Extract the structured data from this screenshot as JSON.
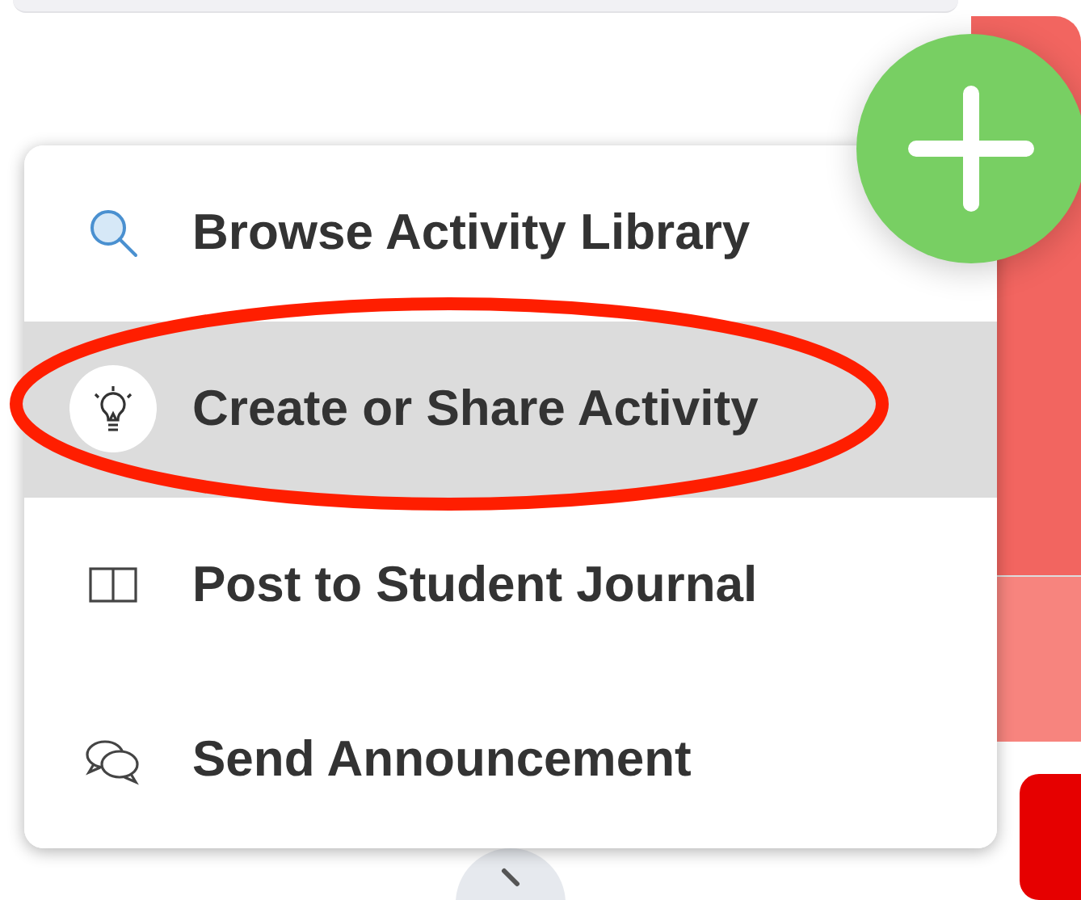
{
  "menu": {
    "items": [
      {
        "kind": "search",
        "label": "Browse Activity Library",
        "selected": false
      },
      {
        "kind": "bulb",
        "label": "Create or Share Activity",
        "selected": true
      },
      {
        "kind": "book",
        "label": "Post to Student Journal",
        "selected": false
      },
      {
        "kind": "chat",
        "label": "Send Announcement",
        "selected": false
      }
    ]
  }
}
